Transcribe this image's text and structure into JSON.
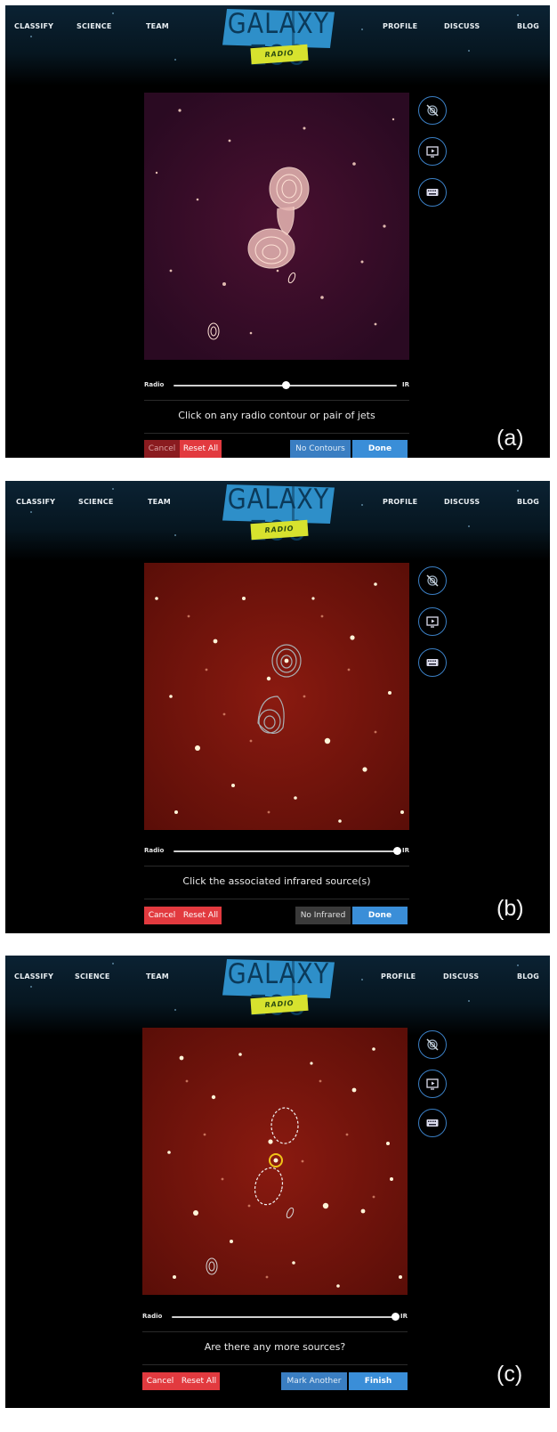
{
  "nav": {
    "classify": "CLASSIFY",
    "science": "SCIENCE",
    "team": "TEAM",
    "profile": "PROFILE",
    "discuss": "DISCUSS",
    "blog": "BLOG"
  },
  "logo": {
    "title_left": "GALAXY",
    "title_right": "ZOO",
    "ribbon": "RADIO"
  },
  "icons": {
    "hide_contours": "crossed-out-contours-icon",
    "examples": "play-screen-icon",
    "keyboard": "keyboard-icon"
  },
  "slider": {
    "left_label": "Radio",
    "right_label": "IR"
  },
  "panel_a": {
    "tag": "(a)",
    "prompt": "Click on any radio contour or pair of jets",
    "slider_value": 0.5,
    "cancel": "Cancel",
    "reset_all": "Reset All",
    "alt_action": "No Contours",
    "primary": "Done"
  },
  "panel_b": {
    "tag": "(b)",
    "prompt": "Click the associated infrared source(s)",
    "slider_value": 1.0,
    "cancel": "Cancel",
    "reset_all": "Reset All",
    "alt_action": "No Infrared",
    "primary": "Done"
  },
  "panel_c": {
    "tag": "(c)",
    "prompt": "Are there any more sources?",
    "slider_value": 1.0,
    "cancel": "Cancel",
    "reset_all": "Reset All",
    "alt_action": "Mark Another",
    "primary": "Finish"
  },
  "colors": {
    "accent_blue": "#3a8ed8",
    "danger_red": "#e23a3f",
    "logo_blue": "#2e8fc9",
    "ribbon_yellow": "#d7e22e",
    "ir_background": "#3a0b08"
  }
}
